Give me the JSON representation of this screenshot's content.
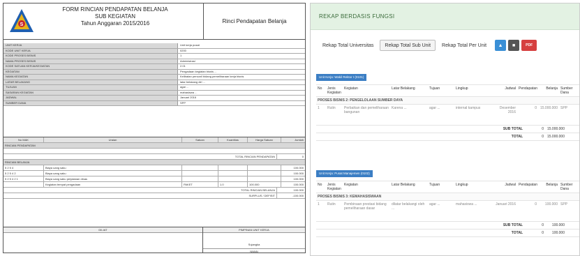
{
  "left_form": {
    "title_lines": [
      "FORM RINCIAN PENDAPATAN BELANJA",
      "SUB KEGIATAN",
      "Tahun Anggaran 2015/2016"
    ],
    "header_right": "Rinci Pendapatan Belanja",
    "info_rows": [
      {
        "label": "UNIT KERJA",
        "value": "Unit kerja pusat"
      },
      {
        "label": "KODE UNIT KERJA",
        "value": "0200"
      },
      {
        "label": "KODE PROSES BISNIS",
        "value": "1"
      },
      {
        "label": "NAMA PROSES BISNIS",
        "value": "Administrasi"
      },
      {
        "label": "KODE SATUAN KERJA/KEGIATAN",
        "value": "2.01"
      },
      {
        "label": "KEGIATAN",
        "value": "Pengadaan kegiatan bisnis ..."
      },
      {
        "label": "NAMA KEGIATAN",
        "value": "Kelibatan personil bidang pemeliharaan kerja bisnis"
      },
      {
        "label": "LATAR BELAKANG",
        "value": "latar belakang diri ..."
      },
      {
        "label": "TUJUAN",
        "value": "agar ..."
      },
      {
        "label": "SASARAN KEGIATAN",
        "value": "mahasiswa ..."
      },
      {
        "label": "JADWAL",
        "value": "Januari 2016"
      },
      {
        "label": "SUMBER DANA",
        "value": "SPP"
      }
    ],
    "kegiatan_header": [
      "No MAK",
      "Uraian",
      "Satuan",
      "Kuantitas",
      "Harga Satuan",
      "Jumlah"
    ],
    "rincian_label": "RINCIAN PENDAPATAN",
    "total_pendapatan_label": "TOTAL RINCIAN PENDAPATAN",
    "total_pendapatan_value": "0",
    "rincian_belanja_label": "RINCIAN BELANJA",
    "belanja_rows": [
      {
        "mak": "5 2 5 4",
        "uraian": "Biaya uang saku",
        "satuan": "",
        "qty": "",
        "harga": "",
        "jumlah": "100.000"
      },
      {
        "mak": "5 2 5 4 2",
        "uraian": "Biaya uang saku",
        "satuan": "",
        "qty": "",
        "harga": "",
        "jumlah": "100.000"
      },
      {
        "mak": "5 2 5 4 2 1",
        "uraian": "Biaya uang saku perjalanan dinas",
        "satuan": "",
        "qty": "",
        "harga": "",
        "jumlah": "100.000"
      },
      {
        "mak": "",
        "uraian": "Kegiatan tempat pengadaan",
        "satuan": "PAKET",
        "qty": "1.0",
        "harga": "100.000",
        "jumlah": "100.000"
      }
    ],
    "total_belanja_label": "TOTAL RINCIAN BELANJA",
    "total_belanja_value": "100.000",
    "surplus_label": "SURPLUS / DEFISIT",
    "surplus_value": "-100.000",
    "sign_left_caption": "DILIAT",
    "sign_right_caption": "PIMPINAN UNIT KERJA",
    "sign_name": "Sujangka",
    "sign_nip": "NNNN"
  },
  "right_panel": {
    "title": "REKAP BERDASIS FUNGSI",
    "tabs": [
      "Rekap Total Universitas",
      "Rekap Total Sub Unit",
      "Rekap Total Per Unit"
    ],
    "active_tab": 1,
    "buttons": [
      {
        "name": "upload-button",
        "glyph": "▲",
        "color": "#3a8fd6"
      },
      {
        "name": "print-button",
        "glyph": "■",
        "color": "#555555"
      },
      {
        "name": "pdf-button",
        "glyph": "PDF",
        "color": "#d64040"
      }
    ],
    "section1": {
      "badge": "Unit Kerja: Wakil Rektor I (0101)",
      "headers": [
        "No",
        "Jenis Kegiatan",
        "Kegiatan",
        "Latar Belakang",
        "Tujuan",
        "Lingkup",
        "Jadwal",
        "Pendapatan",
        "Belanja",
        "Sumber Dana"
      ],
      "program": "PROSES BISNIS 2: PENGELOLAAN SUMBER DAYA",
      "rows": [
        {
          "no": "1",
          "jenis": "Rutin",
          "kegiatan": "Perbaikan dan pemeliharaan bangunan",
          "latar": "Karena ...",
          "tujuan": "agar ...",
          "lingkup": "internal kampus",
          "jadwal": "Desember 2016",
          "pendapatan": "0",
          "belanja": "15.000.000",
          "sumber": "SPP"
        }
      ],
      "subtotal_label": "SUB TOTAL",
      "subtotal_pendapatan": "0",
      "subtotal_belanja": "15.000.000",
      "total_label": "TOTAL",
      "total_pendapatan": "0",
      "total_belanja": "15.000.000"
    },
    "section2": {
      "badge": "Unit Kerja: Pusat Manajemen (0102)",
      "headers": [
        "No",
        "Jenis Kegiatan",
        "Kegiatan",
        "Latar Belakang",
        "Tujuan",
        "Lingkup",
        "Jadwal",
        "Pendapatan",
        "Belanja",
        "Sumber Dana"
      ],
      "program": "PROSES BISNIS 3: KEMAHASISWAAN",
      "rows": [
        {
          "no": "1",
          "jenis": "Rutin",
          "kegiatan": "Pembinaan prestasi bidang pemeliharaan dasar",
          "latar": "dilatar belakangi oleh ...",
          "tujuan": "agar ...",
          "lingkup": "mahasiswa ...",
          "jadwal": "Januari 2016",
          "pendapatan": "0",
          "belanja": "100.000",
          "sumber": "SPP"
        }
      ],
      "subtotal_label": "SUB TOTAL",
      "subtotal_pendapatan": "0",
      "subtotal_belanja": "100.000",
      "total_label": "TOTAL",
      "total_pendapatan": "0",
      "total_belanja": "100.000"
    }
  }
}
